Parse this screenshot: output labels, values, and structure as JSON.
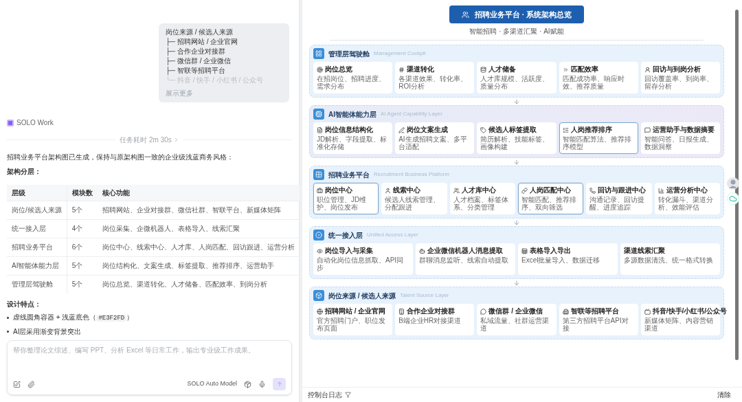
{
  "chat": {
    "user_message": {
      "lines": [
        {
          "text": "岗位来源 / 候选人来源",
          "faded": false
        },
        {
          "text": "├─ 招聘网站 / 企业官网",
          "faded": false
        },
        {
          "text": "├─ 合作企业对接群",
          "faded": false
        },
        {
          "text": "├─ 微信群 / 企业微信",
          "faded": false
        },
        {
          "text": "├─ 智联等招聘平台",
          "faded": false
        },
        {
          "text": "└─ 抖音 / 快手 / 小红书 / 公众号",
          "faded": true
        }
      ],
      "show_more": "展示更多"
    },
    "agent": "SOLO Work",
    "duration": "任务耗时 2m 30s",
    "summary": "招聘业务平台架构图已生成，保持与原架构图一致的企业级浅蓝商务风格：",
    "heading": "架构分层：",
    "table": {
      "columns": [
        "层级",
        "模块数",
        "核心功能"
      ],
      "rows": [
        [
          "岗位/候选人来源",
          "5个",
          "招聘网站、企业对接群、微信社群、智联平台、新媒体矩阵"
        ],
        [
          "统一接入层",
          "4个",
          "岗位采集、企微机器人、表格导入、线索汇聚"
        ],
        [
          "招聘业务平台",
          "6个",
          "岗位中心、线索中心、人才库、人岗匹配、回访跟进、运营分析"
        ],
        [
          "AI智能体能力层",
          "5个",
          "岗位结构化、文案生成、标签提取、推荐排序、运营助手"
        ],
        [
          "管理层驾驶舱",
          "5个",
          "岗位总览、渠道转化、人才储备、匹配效率、到岗分析"
        ]
      ]
    },
    "features_heading": "设计特点：",
    "features": [
      {
        "text": "虚线圆角容器 + 浅蓝底色（",
        "code": "#E3F2FD",
        "after": "）"
      },
      {
        "text": "AI层采用渐变背景突出"
      }
    ],
    "input": {
      "placeholder": "帮你整理论文综述、编写 PPT、分析 Excel 等日常工作，输出专业级工作成果。",
      "model": "SOLO Auto Model"
    }
  },
  "diagram": {
    "title": "招聘业务平台 · 系统架构总览",
    "subtitle": "智能招聘 · 多渠道汇聚 · AI赋能",
    "layers": [
      {
        "kind": "standard",
        "title": "管理层驾驶舱",
        "subtitle": "Management Cockpit",
        "cards": [
          {
            "title": "岗位总览",
            "desc": "在招岗位、招聘进度、需求分布",
            "highlighted": false
          },
          {
            "title": "渠道转化",
            "desc": "各渠道效果、转化率、ROI分析",
            "highlighted": false
          },
          {
            "title": "人才储备",
            "desc": "人才库规模、活跃度、质量分布",
            "highlighted": false
          },
          {
            "title": "匹配效率",
            "desc": "匹配成功率、响应时效、推荐质量",
            "highlighted": false
          },
          {
            "title": "回访与到岗分析",
            "desc": "回访覆盖率、到岗率、留存分析",
            "highlighted": false
          }
        ]
      },
      {
        "kind": "ai",
        "title": "AI智能体能力层",
        "subtitle": "AI Agent Capability Layer",
        "cards": [
          {
            "title": "岗位信息结构化",
            "desc": "JD解析、字段提取、标准化存储",
            "highlighted": false
          },
          {
            "title": "岗位文案生成",
            "desc": "AI生成招聘文案、多平台适配",
            "highlighted": false
          },
          {
            "title": "候选人标签提取",
            "desc": "简历解析、技能标签、画像构建",
            "highlighted": false
          },
          {
            "title": "人岗推荐排序",
            "desc": "智能匹配算法、推荐排序模型",
            "highlighted": true
          },
          {
            "title": "运营助手与数据摘要",
            "desc": "智能问答、日报生成、数据洞察",
            "highlighted": false
          }
        ]
      },
      {
        "kind": "standard",
        "title": "招聘业务平台",
        "subtitle": "Recruitment Business Platform",
        "cards": [
          {
            "title": "岗位中心",
            "desc": "职位管理、JD维护、岗位发布",
            "highlighted": true
          },
          {
            "title": "线索中心",
            "desc": "候选人线索管理、分配跟进",
            "highlighted": false
          },
          {
            "title": "人才库中心",
            "desc": "人才档案、标签体系、分类管理",
            "highlighted": false
          },
          {
            "title": "人岗匹配中心",
            "desc": "智能匹配、推荐排序、双向筛选",
            "highlighted": true
          },
          {
            "title": "回访与跟进中心",
            "desc": "沟通记录、回访提醒、进度追踪",
            "highlighted": false
          },
          {
            "title": "运营分析中心",
            "desc": "转化漏斗、渠道分析、效能评估",
            "highlighted": false
          }
        ]
      },
      {
        "kind": "standard",
        "title": "统一接入层",
        "subtitle": "Unified Access Layer",
        "cards": [
          {
            "title": "岗位导入与采集",
            "desc": "自动化岗位信息抓取、API同步",
            "highlighted": false
          },
          {
            "title": "企业微信机器人消息提取",
            "desc": "群聊消息监听、线索自动提取",
            "highlighted": false
          },
          {
            "title": "表格导入导出",
            "desc": "Excel批量导入、数据迁移",
            "highlighted": false
          },
          {
            "title": "渠道线索汇聚",
            "desc": "多源数据清洗、统一格式转换",
            "highlighted": false
          }
        ]
      },
      {
        "kind": "standard",
        "title": "岗位来源 / 候选人来源",
        "subtitle": "Talent Source Layer",
        "cards": [
          {
            "title": "招聘网站 / 企业官网",
            "desc": "官方招聘门户、职位发布页面",
            "highlighted": false
          },
          {
            "title": "合作企业对接群",
            "desc": "B端企业HR对接渠道",
            "highlighted": false
          },
          {
            "title": "微信群 / 企业微信",
            "desc": "私域流量、社群运营渠道",
            "highlighted": false
          },
          {
            "title": "智联等招聘平台",
            "desc": "第三方招聘平台API对接",
            "highlighted": false
          },
          {
            "title": "抖音/快手/小红书/公众号",
            "desc": "新媒体矩阵、内容营销渠道",
            "highlighted": false
          }
        ]
      }
    ]
  },
  "console": {
    "label": "控制台日志",
    "clear": "清除"
  }
}
